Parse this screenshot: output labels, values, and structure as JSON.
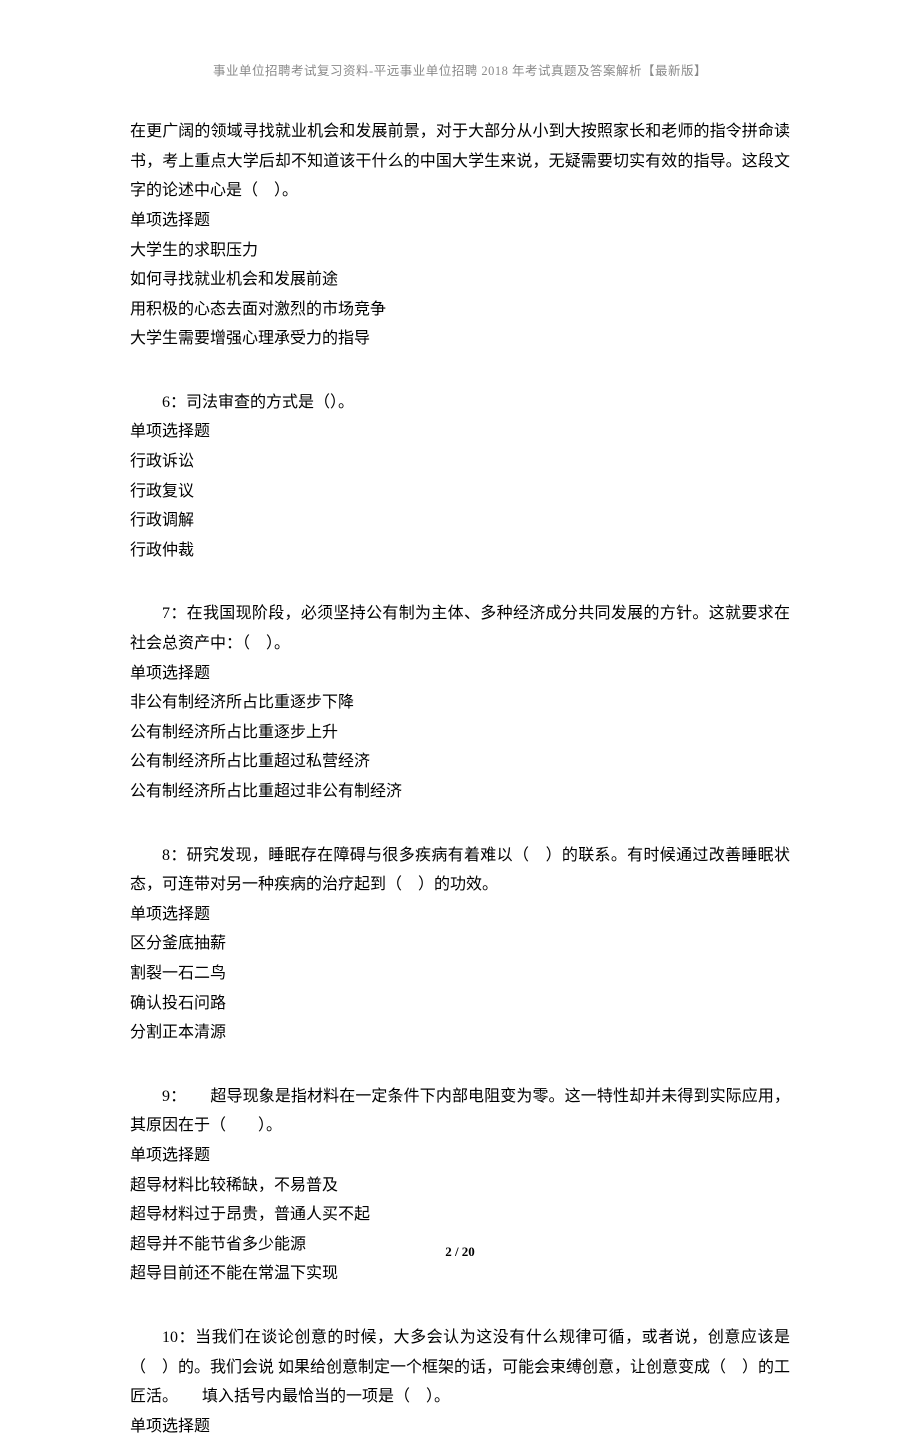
{
  "header": "事业单位招聘考试复习资料-平远事业单位招聘 2018 年考试真题及答案解析【最新版】",
  "footer": "2 / 20",
  "q5": {
    "stem": "在更广阔的领域寻找就业机会和发展前景，对于大部分从小到大按照家长和老师的指令拼命读书，考上重点大学后却不知道该干什么的中国大学生来说，无疑需要切实有效的指导。这段文字的论述中心是（　）。",
    "type": "单项选择题",
    "opts": [
      "大学生的求职压力",
      "如何寻找就业机会和发展前途",
      "用积极的心态去面对激烈的市场竞争",
      "大学生需要增强心理承受力的指导"
    ]
  },
  "q6": {
    "stem": "6：司法审查的方式是（）。",
    "type": "单项选择题",
    "opts": [
      "行政诉讼",
      "行政复议",
      "行政调解",
      "行政仲裁"
    ]
  },
  "q7": {
    "stem": "7：在我国现阶段，必须坚持公有制为主体、多种经济成分共同发展的方针。这就要求在社会总资产中：（　）。",
    "type": "单项选择题",
    "opts": [
      "非公有制经济所占比重逐步下降",
      "公有制经济所占比重逐步上升",
      "公有制经济所占比重超过私营经济",
      "公有制经济所占比重超过非公有制经济"
    ]
  },
  "q8": {
    "stem": "8：研究发现，睡眠存在障碍与很多疾病有着难以（　）的联系。有时候通过改善睡眠状态，可连带对另一种疾病的治疗起到（　）的功效。",
    "type": "单项选择题",
    "opts": [
      "区分釜底抽薪",
      "割裂一石二鸟",
      "确认投石问路",
      "分割正本清源"
    ]
  },
  "q9": {
    "stem": "9：　　超导现象是指材料在一定条件下内部电阻变为零。这一特性却并未得到实际应用，其原因在于（　　）。",
    "type": "单项选择题",
    "opts": [
      "超导材料比较稀缺，不易普及",
      "超导材料过于昂贵，普通人买不起",
      "超导并不能节省多少能源",
      "超导目前还不能在常温下实现"
    ]
  },
  "q10": {
    "stem": "10：当我们在谈论创意的时候，大多会认为这没有什么规律可循，或者说，创意应该是（　）的。我们会说 如果给创意制定一个框架的话，可能会束缚创意，让创意变成（　）的工匠活。　　填入括号内最恰当的一项是（　）。",
    "type": "单项选择题"
  }
}
